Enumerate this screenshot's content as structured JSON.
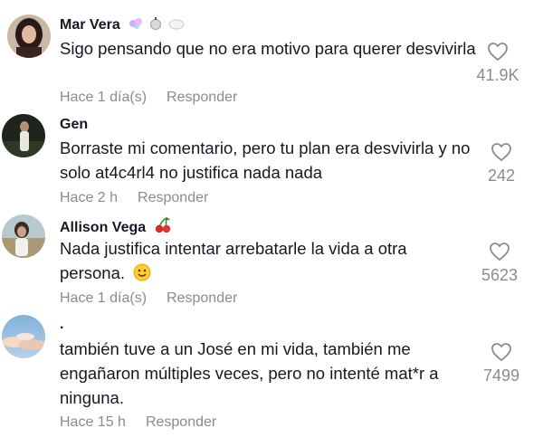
{
  "labels": {
    "reply": "Responder"
  },
  "comments": [
    {
      "username": "Mar Vera",
      "text": "Sigo pensando que no era motivo para querer desvivirla",
      "time": "Hace 1 día(s)",
      "likes": "41.9K"
    },
    {
      "username": "Gen",
      "text": "Borraste mi comentario, pero tu plan era desvivirla y no solo at4c4rl4 no justifica nada nada",
      "time": "Hace 2 h",
      "likes": "242"
    },
    {
      "username": "Allison Vega",
      "text": "Nada justifica intentar arrebatarle la vida a otra persona.",
      "time": "Hace 1 día(s)",
      "likes": "5623"
    },
    {
      "username": ".",
      "text": "también tuve a un José en mi vida, también me engañaron múltiples veces, pero no intenté mat*r a ninguna.",
      "time": "Hace 15 h",
      "likes": "7499"
    }
  ],
  "colors": {
    "text": "#161823",
    "secondary": "#8a8b91",
    "background": "#ffffff"
  }
}
